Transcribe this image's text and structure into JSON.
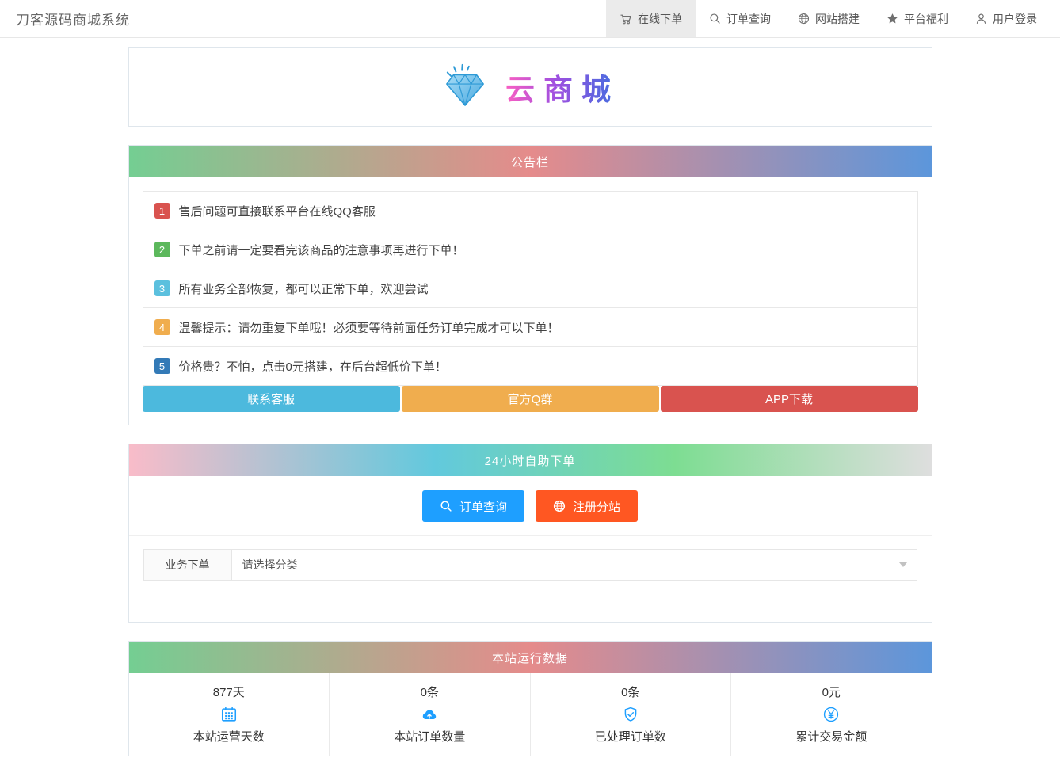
{
  "navbar": {
    "title": "刀客源码商城系统",
    "items": [
      {
        "label": "在线下单",
        "icon": "cart-icon",
        "active": true
      },
      {
        "label": "订单查询",
        "icon": "search-icon",
        "active": false
      },
      {
        "label": "网站搭建",
        "icon": "globe-icon",
        "active": false
      },
      {
        "label": "平台福利",
        "icon": "star-icon",
        "active": false
      },
      {
        "label": "用户登录",
        "icon": "user-icon",
        "active": false
      }
    ]
  },
  "logo": {
    "text": "云商城",
    "icon": "diamond-icon"
  },
  "notice": {
    "title": "公告栏",
    "items": [
      {
        "num": "1",
        "color": "#d9534f",
        "text": "售后问题可直接联系平台在线QQ客服"
      },
      {
        "num": "2",
        "color": "#5cb85c",
        "text": "下单之前请一定要看完该商品的注意事项再进行下单！"
      },
      {
        "num": "3",
        "color": "#5bc0de",
        "text": "所有业务全部恢复，都可以正常下单，欢迎尝试"
      },
      {
        "num": "4",
        "color": "#f0ad4e",
        "text": "温馨提示：请勿重复下单哦！必须要等待前面任务订单完成才可以下单！"
      },
      {
        "num": "5",
        "color": "#337ab7",
        "text": "价格贵？不怕，点击0元搭建，在后台超低价下单！"
      }
    ],
    "buttons": [
      {
        "label": "联系客服",
        "color": "#4cb9dd"
      },
      {
        "label": "官方Q群",
        "color": "#f0ad4e"
      },
      {
        "label": "APP下载",
        "color": "#d9534f"
      }
    ]
  },
  "selfservice": {
    "title": "24小时自助下单",
    "buttons": [
      {
        "label": "订单查询",
        "color": "#1E9FFF",
        "icon": "search-icon"
      },
      {
        "label": "注册分站",
        "color": "#FF5722",
        "icon": "globe-icon"
      }
    ],
    "order_form": {
      "label": "业务下单",
      "select_placeholder": "请选择分类"
    }
  },
  "stats": {
    "title": "本站运行数据",
    "icon_color": "#1E9FFF",
    "items": [
      {
        "value": "877天",
        "label": "本站运营天数",
        "icon": "calendar-icon"
      },
      {
        "value": "0条",
        "label": "本站订单数量",
        "icon": "cloud-upload-icon"
      },
      {
        "value": "0条",
        "label": "已处理订单数",
        "icon": "shield-check-icon"
      },
      {
        "value": "0元",
        "label": "累计交易金额",
        "icon": "yen-circle-icon"
      }
    ]
  }
}
